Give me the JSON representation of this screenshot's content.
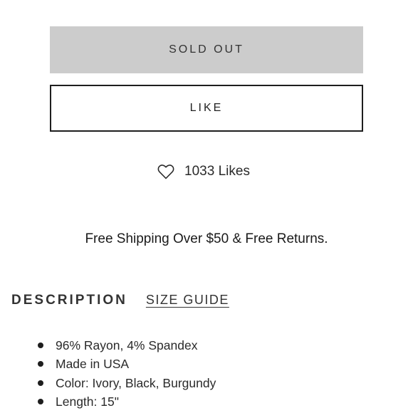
{
  "buttons": {
    "sold_out_label": "SOLD OUT",
    "like_label": "LIKE"
  },
  "likes": {
    "icon": "heart-outline-icon",
    "text": "1033 Likes"
  },
  "shipping": {
    "text": "Free Shipping Over $50 & Free Returns."
  },
  "tabs": {
    "description": "DESCRIPTION",
    "size_guide": "SIZE GUIDE"
  },
  "description": {
    "items": [
      "96% Rayon, 4% Spandex",
      "Made in USA",
      "Color: Ivory, Black, Burgundy",
      "Length: 15\""
    ]
  },
  "colors": {
    "sold_out_bg": "#cccccc",
    "border": "#1e1e1e",
    "text": "#1e1e1e"
  }
}
